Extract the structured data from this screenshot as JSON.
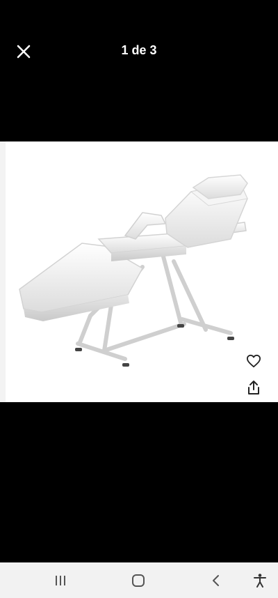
{
  "viewer": {
    "counter_text": "1 de 3"
  },
  "icons": {
    "close": "close-icon",
    "favorite": "heart-outline-icon",
    "share": "share-icon",
    "recents": "recents-icon",
    "home": "home-icon",
    "back": "back-icon",
    "accessibility": "accessibility-icon"
  },
  "colors": {
    "background": "#000000",
    "image_background": "#ffffff",
    "navbar_background": "#f2f2f2",
    "icon_light": "#ffffff",
    "icon_dark": "#222222"
  }
}
